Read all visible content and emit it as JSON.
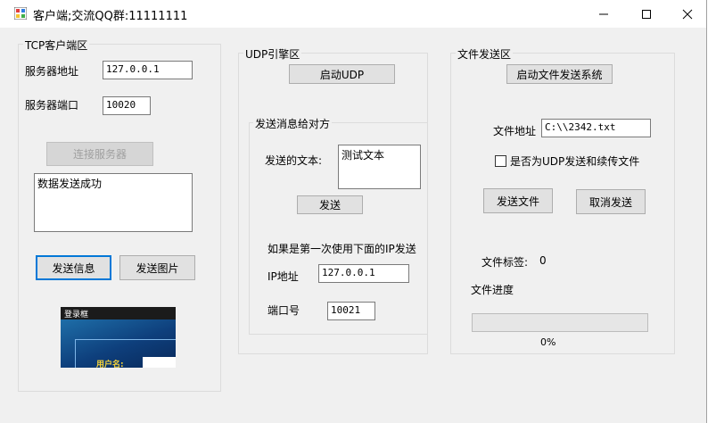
{
  "window": {
    "title": "客户端;交流QQ群:11111111",
    "controls": {
      "minimize": "—",
      "maximize": "☐",
      "close": "✕"
    }
  },
  "tcp": {
    "group_title": "TCP客户端区",
    "server_address_label": "服务器地址",
    "server_address_value": "127.0.0.1",
    "server_port_label": "服务器端口",
    "server_port_value": "10020",
    "connect_button": "连接服务器",
    "message_text": "数据发送成功",
    "send_info_button": "发送信息",
    "send_image_button": "发送图片",
    "thumbnail": {
      "header_text": "登录框",
      "field_label": "用户名:"
    }
  },
  "udp": {
    "group_title": "UDP引擎区",
    "start_button": "启动UDP",
    "send_group_title": "发送消息给对方",
    "send_text_label": "发送的文本:",
    "send_text_value": "测试文本",
    "send_button": "发送",
    "first_time_note": "如果是第一次使用下面的IP发送",
    "ip_label": "IP地址",
    "ip_value": "127.0.0.1",
    "port_label": "端口号",
    "port_value": "10021"
  },
  "file": {
    "group_title": "文件发送区",
    "start_button": "启动文件发送系统",
    "address_label": "文件地址",
    "address_value": "C:\\\\2342.txt",
    "udp_resume_label": "是否为UDP发送和续传文件",
    "udp_resume_checked": false,
    "send_button": "发送文件",
    "cancel_button": "取消发送",
    "tag_label": "文件标签:",
    "tag_value": "0",
    "progress_label": "文件进度",
    "progress_value": 0,
    "progress_text": "0%"
  },
  "colors": {
    "window_bg": "#f0f0f0",
    "focus_border": "#0078d7",
    "progress_fill": "#06b025"
  }
}
